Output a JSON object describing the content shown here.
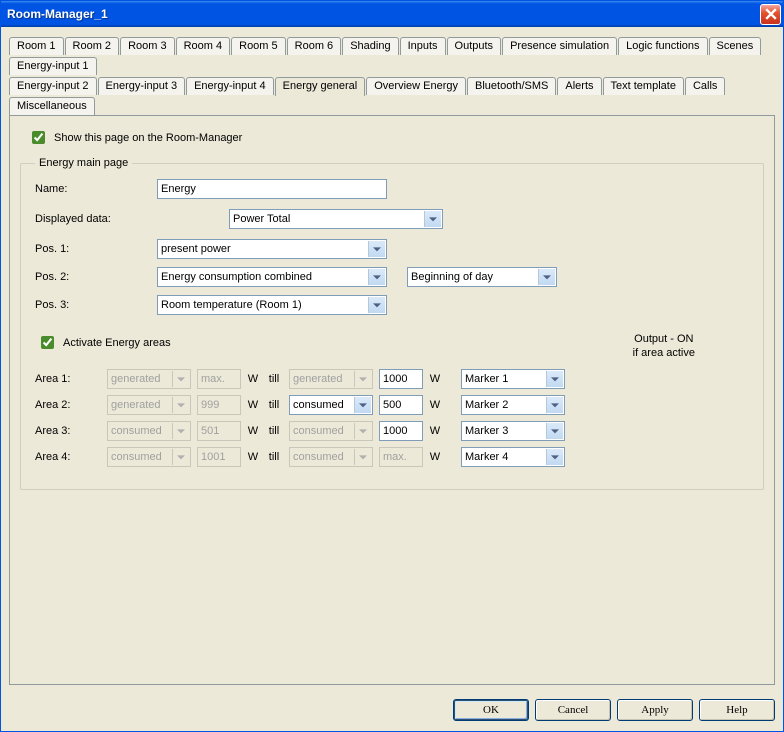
{
  "window": {
    "title": "Room-Manager_1"
  },
  "tabs_row1": [
    "Room 1",
    "Room 2",
    "Room 3",
    "Room 4",
    "Room 5",
    "Room 6",
    "Shading",
    "Inputs",
    "Outputs",
    "Presence simulation",
    "Logic functions",
    "Scenes",
    "Energy-input 1"
  ],
  "tabs_row2": [
    "Energy-input 2",
    "Energy-input 3",
    "Energy-input 4",
    "Energy general",
    "Overview Energy",
    "Bluetooth/SMS",
    "Alerts",
    "Text template",
    "Calls",
    "Miscellaneous"
  ],
  "active_tab": "Energy general",
  "show_page_label": "Show this page on the Room-Manager",
  "show_page_checked": true,
  "fieldset_legend": "Energy main page",
  "labels": {
    "name": "Name:",
    "displayed_data": "Displayed data:",
    "pos1": "Pos. 1:",
    "pos2": "Pos. 2:",
    "pos3": "Pos. 3:",
    "activate": "Activate Energy areas",
    "output_header_1": "Output - ON",
    "output_header_2": "if area active",
    "area1": "Area 1:",
    "area2": "Area 2:",
    "area3": "Area 3:",
    "area4": "Area 4:",
    "W": "W",
    "till": "till"
  },
  "values": {
    "name": "Energy",
    "displayed_data": "Power Total",
    "pos1": "present power",
    "pos2": "Energy consumption combined",
    "pos2_period": "Beginning of day",
    "pos3": "Room temperature (Room 1)",
    "activate_checked": true
  },
  "areas": [
    {
      "label": "Area 1:",
      "type_from": "generated",
      "from_disabled": true,
      "from_val": "max.",
      "from_val_disabled": true,
      "type_to": "generated",
      "to_disabled": true,
      "to_val": "1000",
      "to_val_disabled": false,
      "marker": "Marker 1"
    },
    {
      "label": "Area 2:",
      "type_from": "generated",
      "from_disabled": true,
      "from_val": "999",
      "from_val_disabled": true,
      "type_to": "consumed",
      "to_disabled": false,
      "to_val": "500",
      "to_val_disabled": false,
      "marker": "Marker 2"
    },
    {
      "label": "Area 3:",
      "type_from": "consumed",
      "from_disabled": true,
      "from_val": "501",
      "from_val_disabled": true,
      "type_to": "consumed",
      "to_disabled": true,
      "to_val": "1000",
      "to_val_disabled": false,
      "marker": "Marker 3"
    },
    {
      "label": "Area 4:",
      "type_from": "consumed",
      "from_disabled": true,
      "from_val": "1001",
      "from_val_disabled": true,
      "type_to": "consumed",
      "to_disabled": true,
      "to_val": "max.",
      "to_val_disabled": true,
      "marker": "Marker 4"
    }
  ],
  "buttons": {
    "ok": "OK",
    "cancel": "Cancel",
    "apply": "Apply",
    "help": "Help"
  }
}
